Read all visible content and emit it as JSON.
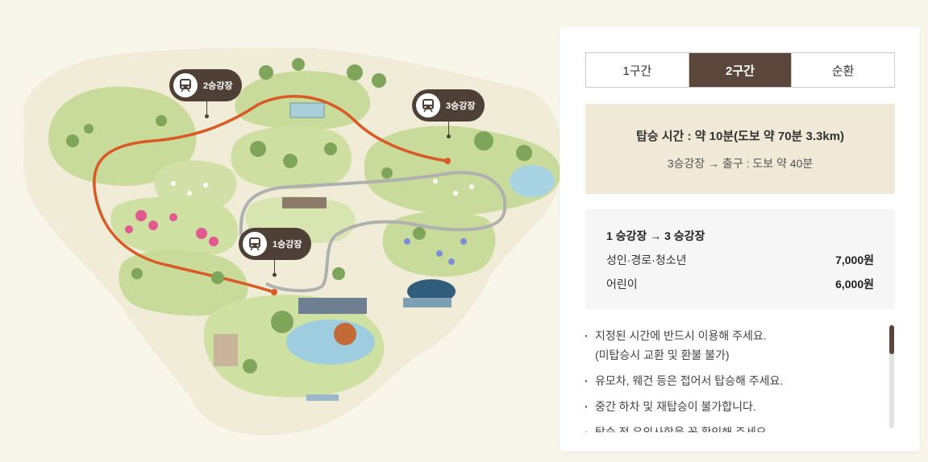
{
  "map": {
    "stations": [
      {
        "label": "2승강장",
        "number": "2"
      },
      {
        "label": "3승강장",
        "number": "3"
      },
      {
        "label": "1승강장",
        "number": "1"
      }
    ]
  },
  "tabs": [
    {
      "label": "1구간",
      "active": false
    },
    {
      "label": "2구간",
      "active": true
    },
    {
      "label": "순환",
      "active": false
    }
  ],
  "ride_time": {
    "main": "탑승 시간 : 약 10분(도보 약 70분 3.3km)",
    "sub": "3승강장 → 출구 : 도보 약 40분"
  },
  "fare": {
    "title": "1 승강장 → 3 승강장",
    "rows": [
      {
        "label": "성인·경로·청소년",
        "price": "7,000원"
      },
      {
        "label": "어린이",
        "price": "6,000원"
      }
    ]
  },
  "notes": [
    {
      "text": "지정된 시간에 반드시 이용해 주세요.",
      "text2": "(미탑승시 교환 및 환불 불가)"
    },
    {
      "text": "유모차, 웨건 등은 접어서 탑승해 주세요."
    },
    {
      "text": "중간 하차 및 재탑승이 불가합니다."
    },
    {
      "text": "탑승 전 유의사항을 꼭 확인해 주세요."
    }
  ],
  "colors": {
    "accent": "#5a463a",
    "route": "#d95a24",
    "loop": "#a7a7a7"
  }
}
